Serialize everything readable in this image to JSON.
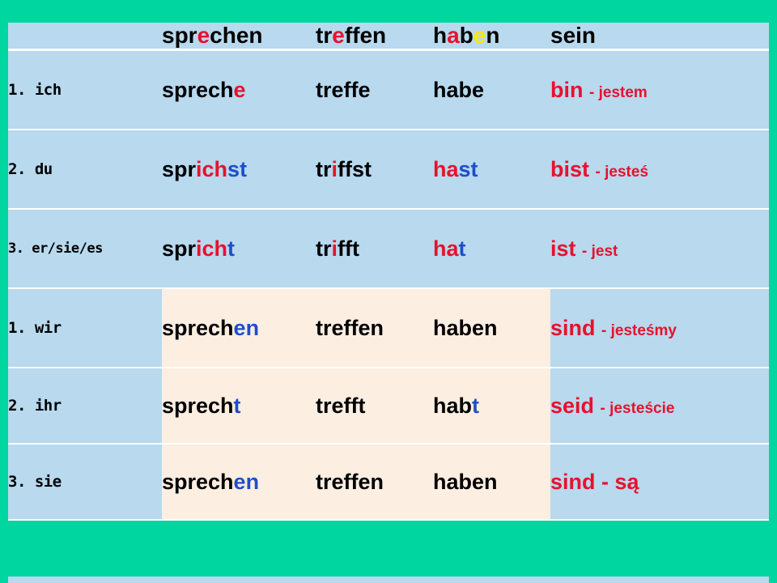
{
  "slide": {
    "background_color": "#00d6a0",
    "table_bg": "#b8d9ee",
    "plural_bg": "#fdeee2",
    "header": {
      "corner": "",
      "verbs": [
        "sprechen",
        "treffen",
        "haben",
        "sein"
      ]
    },
    "rows": [
      {
        "pronoun": "1. ich",
        "plural": false,
        "forms": [
          {
            "stem": "sprech",
            "ending": "e",
            "ending_color": "#e8112d"
          },
          {
            "stem": "treffe",
            "ending": "",
            "ending_color": ""
          },
          {
            "stem": "habe",
            "ending": "",
            "ending_color": ""
          },
          {
            "stem": "bin",
            "ending": "",
            "ending_color": "",
            "translation": "- jestem"
          }
        ]
      },
      {
        "pronoun": "2. du",
        "plural": false,
        "forms": [
          {
            "prefix": "spr",
            "mid": "ich",
            "mid_color": "#e8112d",
            "suffix": "st",
            "suffix_color": "#1f4ec8"
          },
          {
            "prefix": "tr",
            "mid": "i",
            "mid_color": "#e8112d",
            "suffix": "ffst",
            "suffix_color": "#000000"
          },
          {
            "prefix": "h",
            "mid": "a",
            "mid_color": "#e8112d",
            "suffix": "st",
            "suffix_color": "#1f4ec8"
          },
          {
            "stem": "bist",
            "translation": "- jesteś"
          }
        ]
      },
      {
        "pronoun": "3. er/sie/es",
        "plural": false,
        "forms": [
          {
            "prefix": "spr",
            "mid": "ich",
            "mid_color": "#e8112d",
            "suffix": "t",
            "suffix_color": "#1f4ec8"
          },
          {
            "prefix": "tr",
            "mid": "i",
            "mid_color": "#e8112d",
            "suffix": "fft",
            "suffix_color": "#000000"
          },
          {
            "prefix": "h",
            "mid": "a",
            "mid_color": "#e8112d",
            "suffix": "t",
            "suffix_color": "#1f4ec8"
          },
          {
            "stem": "ist",
            "translation": "- jest"
          }
        ]
      },
      {
        "pronoun": "1. wir",
        "plural": true,
        "forms": [
          {
            "stem": "sprech",
            "ending": "en",
            "ending_color": "#1f4ec8"
          },
          {
            "stem": "treffen",
            "ending": "",
            "ending_color": ""
          },
          {
            "stem": "haben",
            "ending": "",
            "ending_color": ""
          },
          {
            "stem": "sind",
            "translation": "- jesteśmy"
          }
        ]
      },
      {
        "pronoun": "2. ihr",
        "plural": true,
        "forms": [
          {
            "stem": "sprech",
            "ending": "t",
            "ending_color": "#1f4ec8"
          },
          {
            "stem": "trefft",
            "ending": "",
            "ending_color": ""
          },
          {
            "stem": "hab",
            "ending": "t",
            "ending_color": "#1f4ec8"
          },
          {
            "stem": "seid",
            "translation": "- jesteście"
          }
        ]
      },
      {
        "pronoun": "3. sie",
        "plural": true,
        "forms": [
          {
            "stem": "sprech",
            "ending": "en",
            "ending_color": "#1f4ec8"
          },
          {
            "stem": "treffen",
            "ending": "",
            "ending_color": ""
          },
          {
            "stem": "haben",
            "ending": "",
            "ending_color": ""
          },
          {
            "stem": "sind - są",
            "translation": ""
          }
        ]
      }
    ]
  }
}
